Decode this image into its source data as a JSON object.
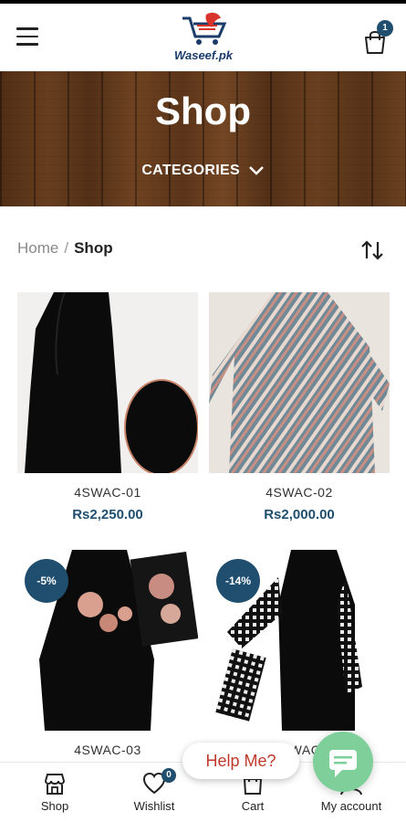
{
  "header": {
    "logo_text": "Waseef.pk",
    "cart_count": "1"
  },
  "banner": {
    "title": "Shop",
    "categories_label": "CATEGORIES"
  },
  "breadcrumb": {
    "home": "Home",
    "separator": "/",
    "current": "Shop"
  },
  "products": [
    {
      "name": "4SWAC-01",
      "price": "Rs2,250.00",
      "discount": ""
    },
    {
      "name": "4SWAC-02",
      "price": "Rs2,000.00",
      "discount": ""
    },
    {
      "name": "4SWAC-03",
      "price": "",
      "discount": "-5%"
    },
    {
      "name": "4SWAC-",
      "price": "",
      "discount": "-14%"
    }
  ],
  "help": {
    "label": "Help Me?"
  },
  "bottom_nav": {
    "shop": "Shop",
    "wishlist": "Wishlist",
    "wishlist_count": "0",
    "cart": "Cart",
    "account": "My account"
  },
  "colors": {
    "accent": "#1f4e6e",
    "help_text": "#c0392b",
    "chat_button": "#7fcf9a"
  },
  "icons": [
    "menu-icon",
    "cart-icon",
    "chevron-down-icon",
    "sort-icon",
    "shop-icon",
    "heart-icon",
    "user-icon",
    "chat-icon"
  ]
}
